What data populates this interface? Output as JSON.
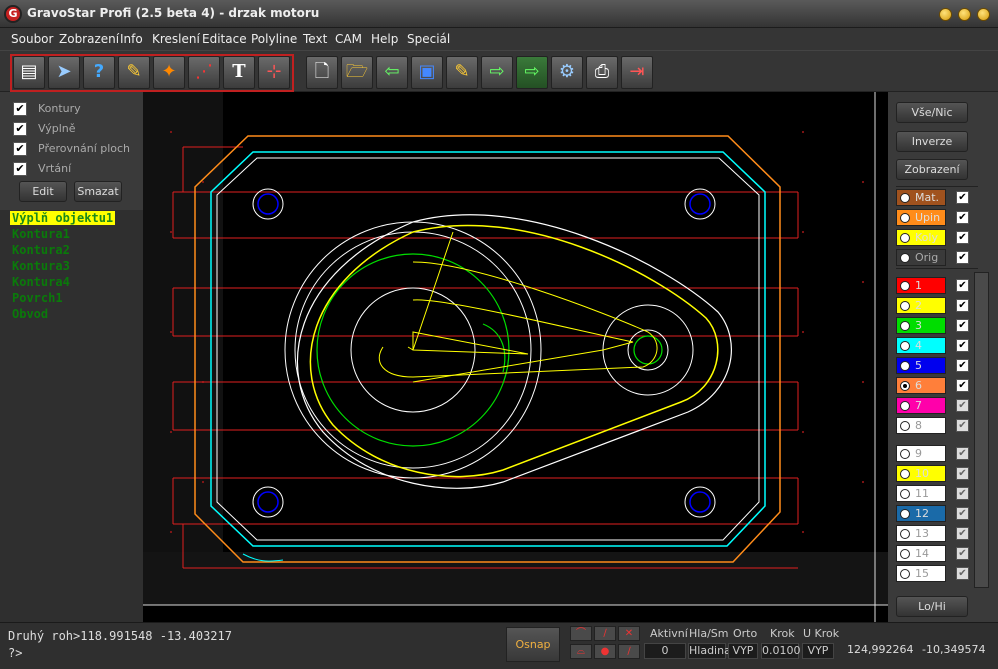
{
  "window": {
    "title": "GravoStar Profi (2.5 beta 4) - drzak motoru",
    "icon_letter": "G"
  },
  "menu": [
    "Soubor",
    "Zobrazení",
    "Info",
    "Kreslení",
    "Editace",
    "Polyline",
    "Text",
    "CAM",
    "Help",
    "Speciál"
  ],
  "toolbar": {
    "group1": [
      {
        "icon": "document-icon",
        "glyph": "▤"
      },
      {
        "icon": "arrow-icon",
        "glyph": "➤"
      },
      {
        "icon": "help-icon",
        "glyph": "?"
      },
      {
        "icon": "pencil-icon",
        "glyph": "✎"
      },
      {
        "icon": "shape-edit-icon",
        "glyph": "✦"
      },
      {
        "icon": "node-edit-icon",
        "glyph": "⋰"
      },
      {
        "icon": "text-icon",
        "glyph": "T"
      },
      {
        "icon": "measure-icon",
        "glyph": "⊹"
      }
    ],
    "group2": [
      {
        "icon": "new-file-icon",
        "glyph": "🗋"
      },
      {
        "icon": "open-folder-icon",
        "glyph": "🗁"
      },
      {
        "icon": "import-icon",
        "glyph": "⇦"
      },
      {
        "icon": "save-icon",
        "glyph": "▣"
      },
      {
        "icon": "edit-file-icon",
        "glyph": "✎"
      },
      {
        "icon": "export-icon",
        "glyph": "⇨"
      },
      {
        "icon": "export-green-icon",
        "glyph": "⇨"
      },
      {
        "icon": "settings-gears-icon",
        "glyph": "⚙"
      },
      {
        "icon": "print-icon",
        "glyph": "⎙"
      },
      {
        "icon": "exit-icon",
        "glyph": "⇥"
      }
    ]
  },
  "left_panel": {
    "checkboxes": [
      {
        "label": "Kontury",
        "checked": true
      },
      {
        "label": "Výplně",
        "checked": true
      },
      {
        "label": "Přerovnání ploch",
        "checked": true
      },
      {
        "label": "Vrtání",
        "checked": true
      }
    ],
    "edit_label": "Edit",
    "delete_label": "Smazat",
    "check_mark": "✔",
    "objects": [
      {
        "name": "Výplň objektu1",
        "selected": true
      },
      {
        "name": "Kontura1",
        "selected": false
      },
      {
        "name": "Kontura2",
        "selected": false
      },
      {
        "name": "Kontura3",
        "selected": false
      },
      {
        "name": "Kontura4",
        "selected": false
      },
      {
        "name": "Povrch1",
        "selected": false
      },
      {
        "name": "Obvod",
        "selected": false
      }
    ]
  },
  "right_panel": {
    "buttons": [
      "Vše/Nic",
      "Inverze",
      "Zobrazení"
    ],
    "bottom_button": "Lo/Hi",
    "special_layers": [
      {
        "label": "Mat.",
        "color": "#a0521e",
        "checked": true,
        "text": "#ddd"
      },
      {
        "label": "Upin",
        "color": "#ff8c1a",
        "checked": true,
        "text": "#ddd"
      },
      {
        "label": "Koly",
        "color": "#ffff00",
        "checked": true,
        "text": "#ddd"
      },
      {
        "label": "Orig",
        "color": "#3a3a3a",
        "checked": true,
        "text": "#aaa"
      }
    ],
    "layers": [
      {
        "label": "1",
        "color": "#ff0000",
        "checked": true,
        "text": "#ddd"
      },
      {
        "label": "2",
        "color": "#ffff00",
        "checked": true,
        "text": "#ddd"
      },
      {
        "label": "3",
        "color": "#00dd00",
        "checked": true,
        "text": "#ddd"
      },
      {
        "label": "4",
        "color": "#00ffff",
        "checked": true,
        "text": "#ddd"
      },
      {
        "label": "5",
        "color": "#0000ee",
        "checked": true,
        "text": "#ddd"
      },
      {
        "label": "6",
        "color": "#ff7f3a",
        "checked": true,
        "text": "#ddd",
        "active": true
      },
      {
        "label": "7",
        "color": "#ff00aa",
        "checked": false,
        "text": "#ddd"
      },
      {
        "label": "8",
        "color": "#ffffff",
        "checked": false,
        "text": "#999"
      },
      {
        "label": "9",
        "color": "#ffffff",
        "checked": false,
        "text": "#999"
      },
      {
        "label": "10",
        "color": "#ffff00",
        "checked": false,
        "text": "#ddd"
      },
      {
        "label": "11",
        "color": "#ffffff",
        "checked": false,
        "text": "#999"
      },
      {
        "label": "12",
        "color": "#1a6aa8",
        "checked": false,
        "text": "#ddd"
      },
      {
        "label": "13",
        "color": "#ffffff",
        "checked": false,
        "text": "#999"
      },
      {
        "label": "14",
        "color": "#ffffff",
        "checked": false,
        "text": "#999"
      },
      {
        "label": "15",
        "color": "#ffffff",
        "checked": false,
        "text": "#999"
      }
    ]
  },
  "status": {
    "cmd_line1": "Druhý roh>118.991548 -13.403217",
    "cmd_line2": "?>",
    "osnap_label": "Osnap",
    "labels": {
      "aktivni": "Aktivní",
      "hlasm": "Hla/Sm",
      "orto": "Orto",
      "krok": "Krok",
      "ukrok": "U Krok"
    },
    "values": {
      "aktivni": "0",
      "hlasm": "Hladina",
      "orto": "VYP",
      "krok": "0.0100",
      "ukrok": "VYP"
    },
    "coord_x": "124,992264",
    "coord_y": "-10,349574"
  }
}
